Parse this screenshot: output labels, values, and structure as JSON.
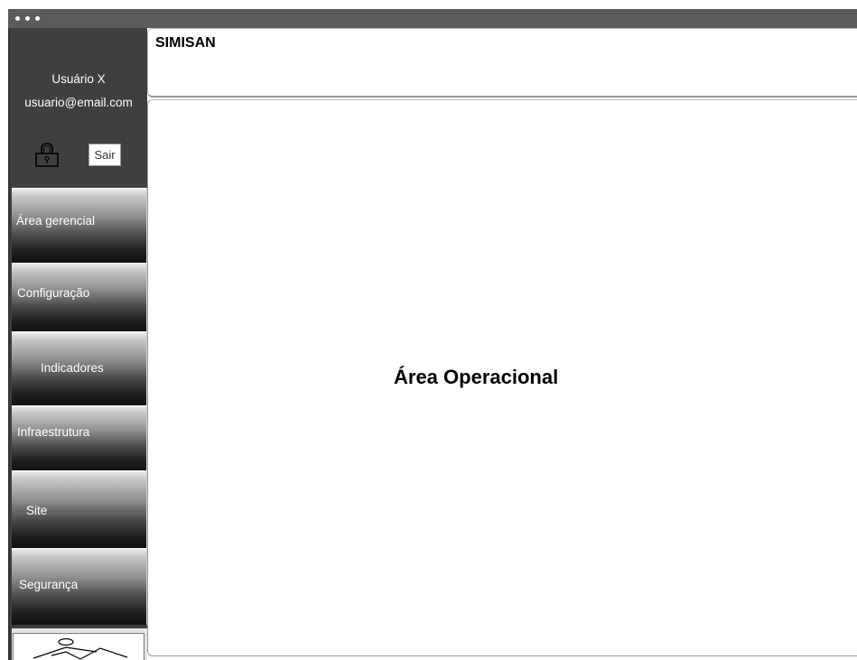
{
  "window": {
    "controls": [
      "dot",
      "dot",
      "dot"
    ]
  },
  "user": {
    "name": "Usuário X",
    "email": "usuario@email.com",
    "logout_label": "Sair"
  },
  "icons": {
    "lock": "lock-icon",
    "logo": "logo-placeholder-icon"
  },
  "sidebar": {
    "items": [
      {
        "label": "Área gerencial"
      },
      {
        "label": "Configuração"
      },
      {
        "label": "Indicadores"
      },
      {
        "label": "Infraestrutura"
      },
      {
        "label": "Site"
      },
      {
        "label": "Segurança"
      }
    ]
  },
  "header": {
    "title": "SIMISAN"
  },
  "main": {
    "title": "Área Operacional"
  },
  "colors": {
    "titlebar": "#5b5b5b",
    "sidebar": "#3f3f3f",
    "menu_text": "#ffffff"
  }
}
